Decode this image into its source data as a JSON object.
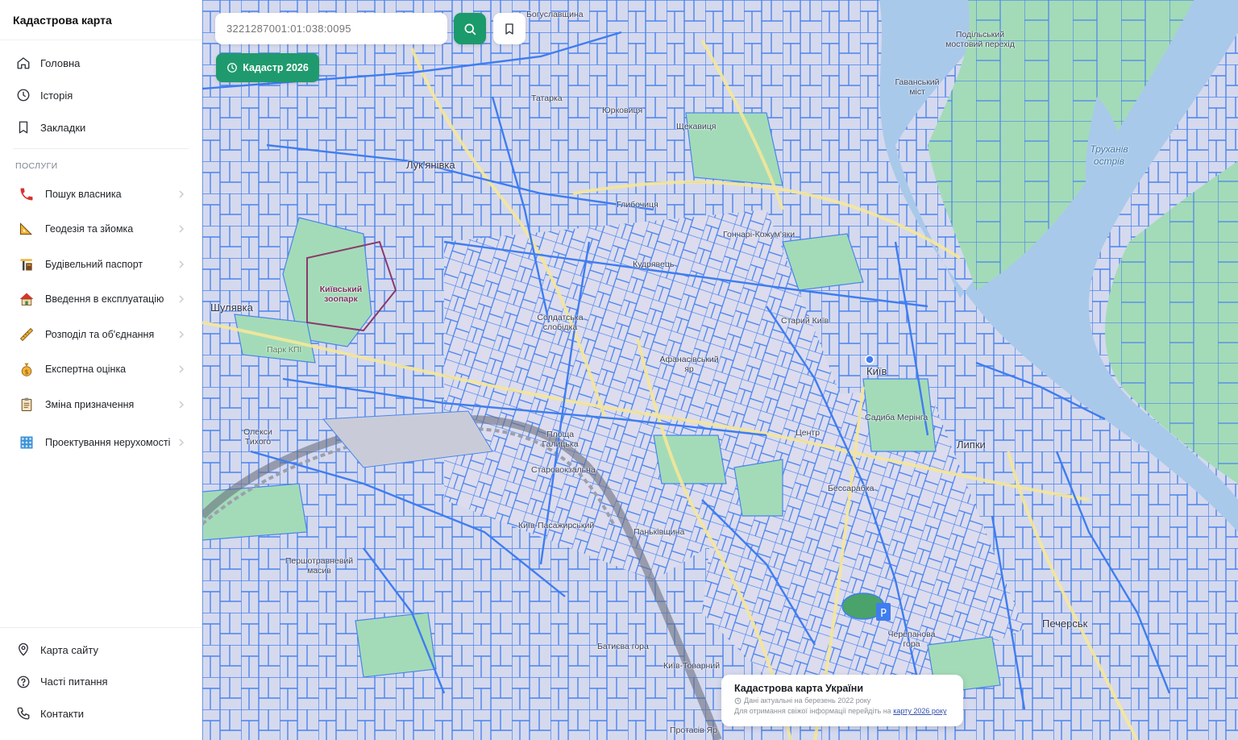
{
  "app": {
    "title": "Кадастрова карта"
  },
  "nav": {
    "top": [
      {
        "label": "Головна",
        "icon": "home-icon"
      },
      {
        "label": "Історія",
        "icon": "clock-icon"
      },
      {
        "label": "Закладки",
        "icon": "bookmark-icon"
      }
    ],
    "section_label": "ПОСЛУГИ",
    "services": [
      {
        "label": "Пошук власника",
        "icon": "phone-icon"
      },
      {
        "label": "Геодезія та зйомка",
        "icon": "ruler-triangle-icon"
      },
      {
        "label": "Будівельний паспорт",
        "icon": "crane-icon"
      },
      {
        "label": "Введення в експлуатацію",
        "icon": "house-icon"
      },
      {
        "label": "Розподіл та об'єднання",
        "icon": "ruler-icon"
      },
      {
        "label": "Експертна оцінка",
        "icon": "money-bag-icon"
      },
      {
        "label": "Зміна призначення",
        "icon": "clipboard-icon"
      },
      {
        "label": "Проектування нерухомості",
        "icon": "building-grid-icon"
      }
    ],
    "bottom": [
      {
        "label": "Карта сайту",
        "icon": "map-pin-icon"
      },
      {
        "label": "Часті питання",
        "icon": "question-icon"
      },
      {
        "label": "Контакти",
        "icon": "phone-outline-icon"
      }
    ]
  },
  "search": {
    "value": "3221287001:01:038:0095",
    "placeholder": "3221287001:01:038:0095"
  },
  "kadastr_button": {
    "label": "Кадастр 2026"
  },
  "info_card": {
    "title": "Кадастрова карта України",
    "date_line": "Дані актуальні на березень 2022 року",
    "note_prefix": "Для отримання свіжої інформації перейдіть на",
    "note_link": "карту 2026 року"
  },
  "map_labels": [
    {
      "text": "Богуславщина",
      "cls": ""
    },
    {
      "text": "Подільський мостовий перехід",
      "cls": ""
    },
    {
      "text": "Татарка",
      "cls": ""
    },
    {
      "text": "Юрковиця",
      "cls": ""
    },
    {
      "text": "Гаванський міст",
      "cls": ""
    },
    {
      "text": "Лук'янівка",
      "cls": "big"
    },
    {
      "text": "Щекавиця",
      "cls": ""
    },
    {
      "text": "Труханів острів",
      "cls": "water"
    },
    {
      "text": "Глибочиця",
      "cls": ""
    },
    {
      "text": "Гончарі-Кожум'яки",
      "cls": ""
    },
    {
      "text": "Кудрявець",
      "cls": ""
    },
    {
      "text": "Київський зоопарк",
      "cls": "park"
    },
    {
      "text": "Шулявка",
      "cls": "big"
    },
    {
      "text": "Солдатська слобідка",
      "cls": ""
    },
    {
      "text": "Старий Київ",
      "cls": ""
    },
    {
      "text": "Афанасівський яр",
      "cls": ""
    },
    {
      "text": "Київ",
      "cls": "big"
    },
    {
      "text": "Садиба Мерінга",
      "cls": ""
    },
    {
      "text": "Площа Галицька",
      "cls": ""
    },
    {
      "text": "Центр",
      "cls": ""
    },
    {
      "text": "Липки",
      "cls": ""
    },
    {
      "text": "Старовокзальна",
      "cls": ""
    },
    {
      "text": "Бессарабка",
      "cls": ""
    },
    {
      "text": "Київ-Пасажирський",
      "cls": ""
    },
    {
      "text": "Паньківщина",
      "cls": ""
    },
    {
      "text": "Першотравневий масив",
      "cls": ""
    },
    {
      "text": "Черепанова гора",
      "cls": ""
    },
    {
      "text": "Печерськ",
      "cls": "big"
    },
    {
      "text": "Батиєва гора",
      "cls": ""
    },
    {
      "text": "Київ-Товарний",
      "cls": ""
    },
    {
      "text": "Протасів Яр",
      "cls": ""
    },
    {
      "text": "Парк КПІ",
      "cls": "park"
    },
    {
      "text": "Олекси Тихого",
      "cls": ""
    }
  ],
  "colors": {
    "accent": "#1b9a6b",
    "parcel_stroke": "#3f7df0",
    "water": "#a9c9ea",
    "park": "#9fd8b4",
    "map_bg": "#d7dcef"
  }
}
